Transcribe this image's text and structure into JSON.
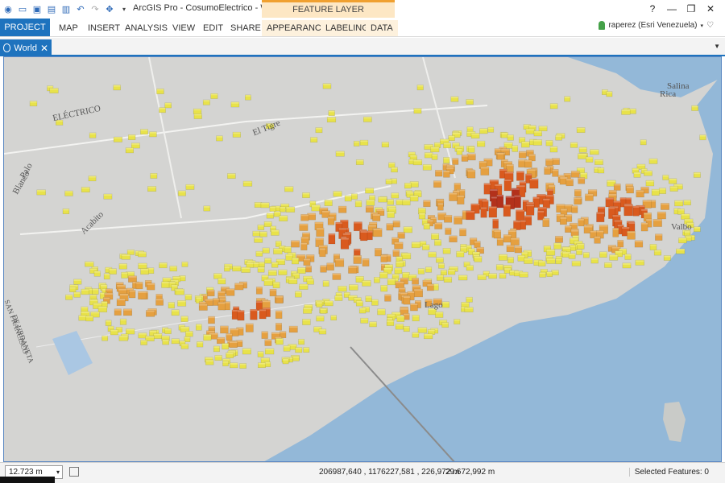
{
  "window": {
    "title": "ArcGIS Pro - CosumoElectrico - World",
    "context_label": "FEATURE LAYER",
    "controls": [
      "?",
      "—",
      "❐",
      "✕"
    ]
  },
  "quick_access": [
    "arcgis-logo-icon",
    "new-icon",
    "open-icon",
    "save-icon",
    "save-as-icon",
    "undo-icon",
    "redo-icon",
    "navigate-icon",
    "customize-icon"
  ],
  "ribbon": {
    "tabs": [
      {
        "label": "PROJECT",
        "active": true
      },
      {
        "label": "MAP"
      },
      {
        "label": "INSERT"
      },
      {
        "label": "ANALYSIS"
      },
      {
        "label": "VIEW"
      },
      {
        "label": "EDIT"
      },
      {
        "label": "SHARE"
      },
      {
        "label": "APPEARANCE",
        "contextual": true
      },
      {
        "label": "LABELING",
        "contextual": true
      },
      {
        "label": "DATA",
        "contextual": true
      }
    ],
    "user": "raperez (Esri Venezuela)"
  },
  "view": {
    "tab_label": "World",
    "close": "✕",
    "dropdown": "▼"
  },
  "map": {
    "labels": [
      {
        "text": "ELÉCTRICO",
        "name": "label-electrico"
      },
      {
        "text": "El Tigre",
        "name": "label-el-tigre"
      },
      {
        "text": "Salina",
        "name": "label-salina-1"
      },
      {
        "text": "Rica",
        "name": "label-salina-2"
      },
      {
        "text": "Lago",
        "name": "label-lago"
      },
      {
        "text": "Palo",
        "name": "label-palo"
      },
      {
        "text": "Blanco",
        "name": "label-blanco"
      },
      {
        "text": "Acabito",
        "name": "label-acabito"
      },
      {
        "text": "SAN FRANCISCO",
        "name": "label-san-francisco"
      },
      {
        "text": "DE URDANETA",
        "name": "label-urdaneta"
      },
      {
        "text": "Valbo",
        "name": "label-valbo"
      }
    ],
    "colors": {
      "land": "#d4d4d2",
      "water": "#93b8d8",
      "low": "#e8e24a",
      "mid": "#e5a040",
      "high": "#d95a1e",
      "peak": "#b3311b"
    }
  },
  "status": {
    "scale": "12.723 m",
    "coordinates": "206987,640 , 1176227,581 , 226,972 m",
    "elevation": "29.672,992 m",
    "selected": "Selected Features: 0"
  }
}
